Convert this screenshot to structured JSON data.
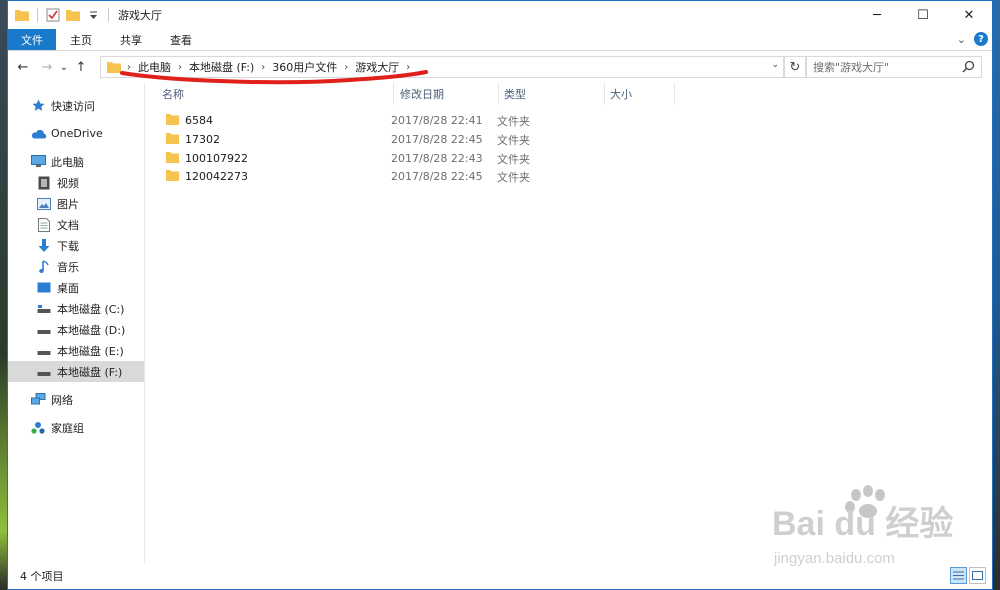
{
  "window": {
    "title": "游戏大厅",
    "controls": {
      "minimize": "─",
      "maximize": "☐",
      "close": "✕"
    }
  },
  "ribbon": {
    "tabs": [
      "文件",
      "主页",
      "共享",
      "查看"
    ],
    "expand": "⌄",
    "help": "?"
  },
  "nav_buttons": {
    "back": "←",
    "forward": "→",
    "recent": "⌄",
    "up": "↑"
  },
  "address": {
    "crumbs": [
      "此电脑",
      "本地磁盘 (F:)",
      "360用户文件",
      "游戏大厅"
    ],
    "separator": "›",
    "refresh": "↻",
    "dropdown": "⌄"
  },
  "search": {
    "placeholder": "搜索\"游戏大厅\""
  },
  "nav_pane": {
    "items": [
      {
        "label": "快速访问",
        "icon": "star-icon",
        "level": 0
      },
      {
        "label": "OneDrive",
        "icon": "cloud-icon",
        "level": 0
      },
      {
        "label": "此电脑",
        "icon": "computer-icon",
        "level": 0
      },
      {
        "label": "视频",
        "icon": "video-icon",
        "level": 1
      },
      {
        "label": "图片",
        "icon": "pictures-icon",
        "level": 1
      },
      {
        "label": "文档",
        "icon": "documents-icon",
        "level": 1
      },
      {
        "label": "下载",
        "icon": "download-icon",
        "level": 1
      },
      {
        "label": "音乐",
        "icon": "music-icon",
        "level": 1
      },
      {
        "label": "桌面",
        "icon": "desktop-icon",
        "level": 1
      },
      {
        "label": "本地磁盘 (C:)",
        "icon": "drive-icon",
        "level": 1
      },
      {
        "label": "本地磁盘 (D:)",
        "icon": "drive-icon",
        "level": 1
      },
      {
        "label": "本地磁盘 (E:)",
        "icon": "drive-icon",
        "level": 1
      },
      {
        "label": "本地磁盘 (F:)",
        "icon": "drive-icon",
        "level": 1,
        "selected": true
      },
      {
        "label": "网络",
        "icon": "network-icon",
        "level": 0
      },
      {
        "label": "家庭组",
        "icon": "homegroup-icon",
        "level": 0
      }
    ]
  },
  "columns": {
    "name": "名称",
    "date": "修改日期",
    "type": "类型",
    "size": "大小"
  },
  "files": [
    {
      "name": "6584",
      "date": "2017/8/28 22:41",
      "type": "文件夹"
    },
    {
      "name": "17302",
      "date": "2017/8/28 22:45",
      "type": "文件夹"
    },
    {
      "name": "100107922",
      "date": "2017/8/28 22:43",
      "type": "文件夹"
    },
    {
      "name": "120042273",
      "date": "2017/8/28 22:45",
      "type": "文件夹"
    }
  ],
  "status": {
    "count": "4 个项目"
  },
  "watermark": {
    "brand": "Bai du 经验",
    "url": "jingyan.baidu.com"
  },
  "colors": {
    "accent": "#1979ca",
    "folder": "#f4c44e",
    "annotation": "#e0201b"
  }
}
